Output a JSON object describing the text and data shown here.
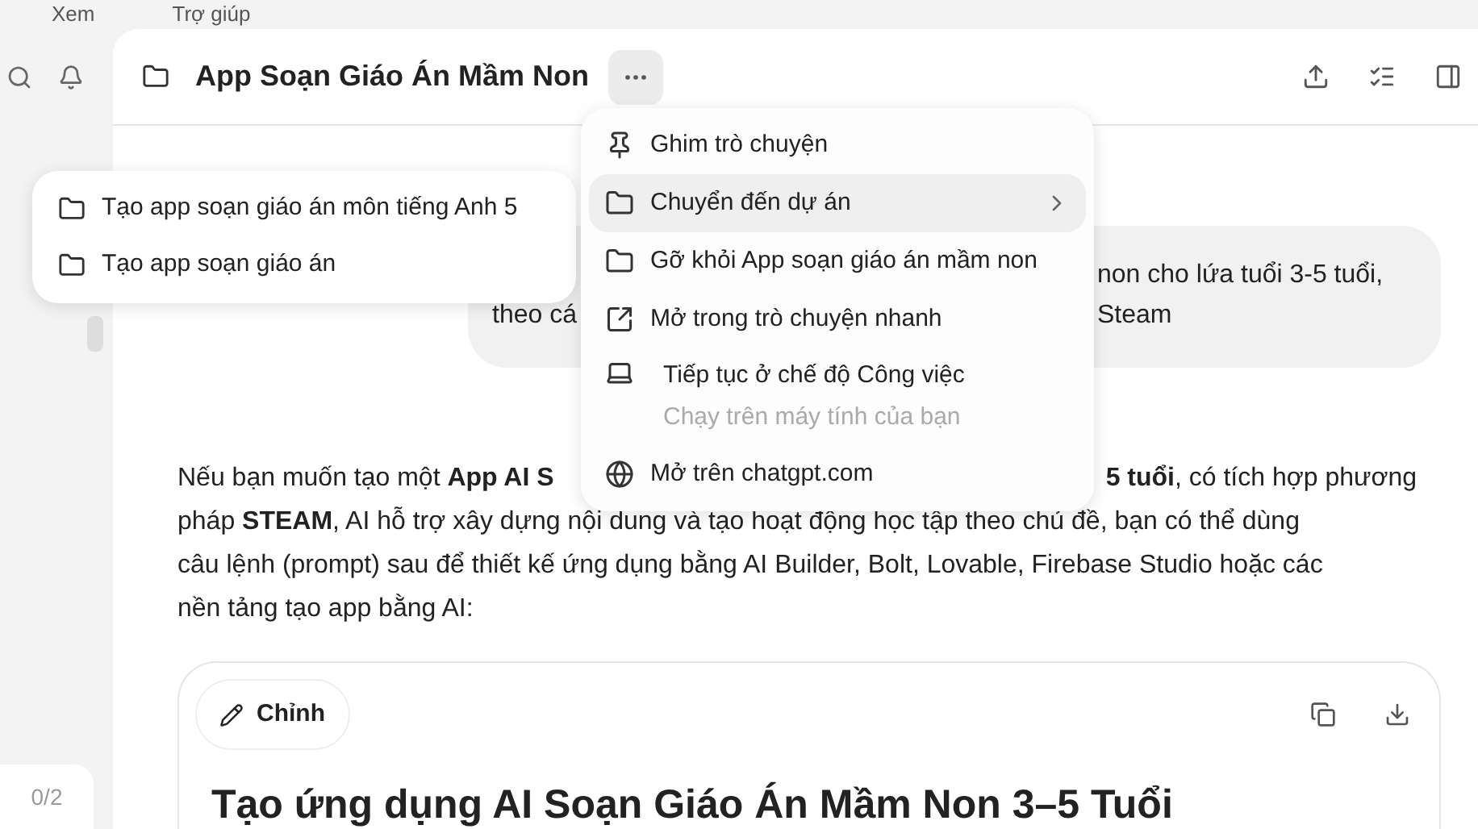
{
  "menu_bar": [
    "Xem",
    "Trợ giúp"
  ],
  "sidebar": {
    "counter": "0/2"
  },
  "header": {
    "title": "App Soạn Giáo Án Mầm Non"
  },
  "user_message": {
    "lines": [
      {
        "right": "non cho lứa tuổi 3-5 tuổi,"
      },
      {
        "left": "theo cá",
        "right": "Steam"
      }
    ]
  },
  "answer": {
    "lines": [
      {
        "left": "Nếu bạn muốn tạo một **App AI S**",
        "right": "**5 tuổi**, có tích hợp phương"
      },
      {
        "left": "pháp **STEAM**, AI hỗ trợ xây dựng nội dung và tạo hoạt động học tập theo chủ đề, bạn có thể dùng"
      },
      {
        "left": "câu lệnh (prompt) sau để thiết kế ứng dụng bằng AI Builder, Bolt, Lovable, Firebase Studio hoặc các"
      },
      {
        "left": "nền tảng tạo app bằng AI:"
      }
    ]
  },
  "canvas_card": {
    "edit_button": "Chỉnh",
    "heading": "Tạo ứng dụng AI Soạn Giáo Án Mầm Non 3–5 Tuổi"
  },
  "project_submenu": [
    {
      "label": "Tạo app soạn giáo án môn tiếng Anh 5"
    },
    {
      "label": "Tạo app soạn giáo án"
    }
  ],
  "context_menu": [
    {
      "kind": "pin",
      "label": "Ghim trò chuyện",
      "selected": false
    },
    {
      "kind": "folder",
      "label": "Chuyển đến dự án",
      "selected": true,
      "submenu": true
    },
    {
      "kind": "folder",
      "label": "Gỡ khỏi App soạn giáo án mầm non",
      "selected": false
    },
    {
      "kind": "quick",
      "label": "Mở trong trò chuyện nhanh",
      "selected": false
    },
    {
      "kind": "laptop",
      "label": "Tiếp tục ở chế độ Công việc",
      "sublabel": "Chạy trên máy tính của bạn",
      "selected": false
    },
    {
      "kind": "globe",
      "label": "Mở trên chatgpt.com",
      "selected": false
    }
  ]
}
